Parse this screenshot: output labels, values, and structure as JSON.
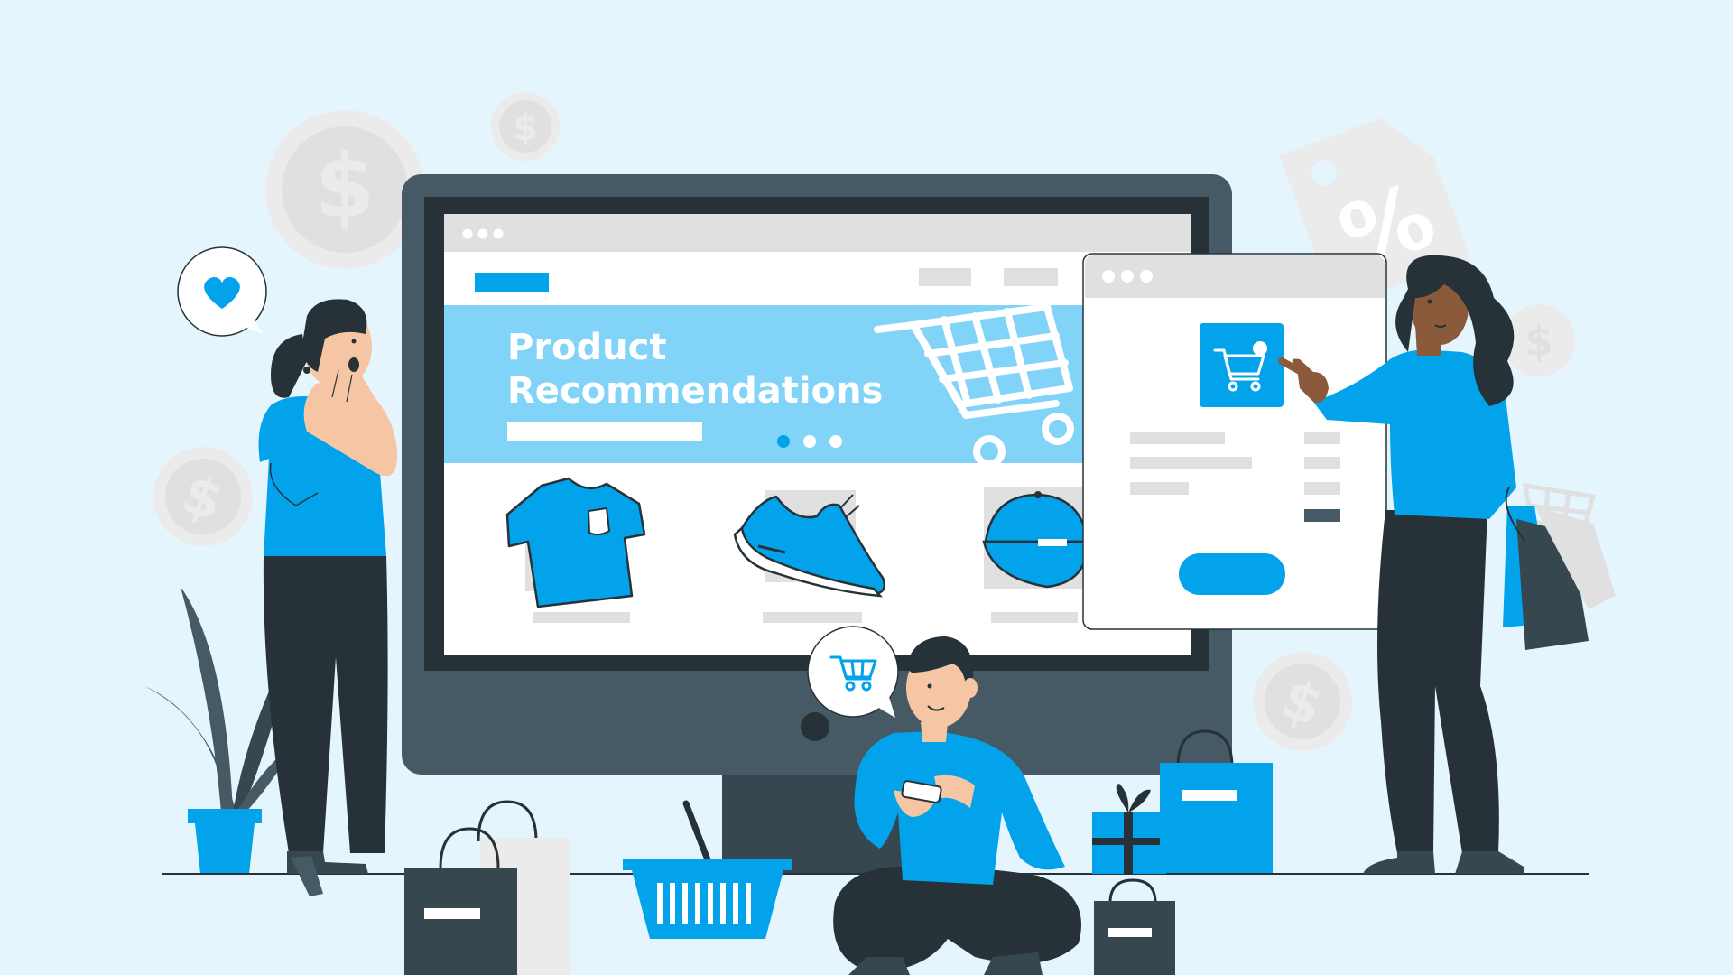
{
  "colors": {
    "background": "#E5F5FD",
    "accent": "#03A3EC",
    "accent_light": "#82D3F8",
    "monitor": "#455A64",
    "monitor_dark": "#263238",
    "screen": "#FFFFFF",
    "placeholder": "#E0E0E0",
    "coin": "#EBEBEB",
    "coin_symbol": "#E0E0E0",
    "skin_light": "#F6C6A4",
    "skin_dark": "#8A5A3B",
    "hair": "#263238",
    "pants": "#263238"
  },
  "banner": {
    "title_line1": "Product",
    "title_line2": "Recommendations"
  },
  "coins": {
    "symbol": "$"
  },
  "price_tag": {
    "symbol": "%"
  },
  "speech_bubbles": {
    "left": "heart-icon",
    "center": "shopping-cart-icon"
  },
  "products": [
    {
      "name": "t-shirt-icon"
    },
    {
      "name": "sneaker-icon"
    },
    {
      "name": "cap-icon"
    }
  ],
  "carousel_dots": 3,
  "carousel_active_index": 0
}
